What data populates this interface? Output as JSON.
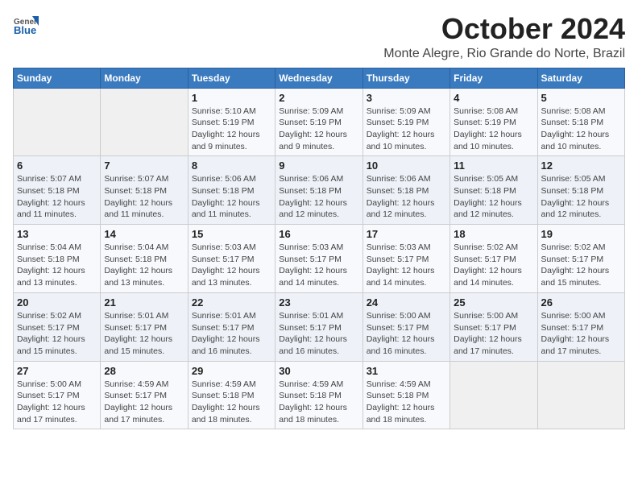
{
  "header": {
    "logo_general": "General",
    "logo_blue": "Blue",
    "month": "October 2024",
    "location": "Monte Alegre, Rio Grande do Norte, Brazil"
  },
  "weekdays": [
    "Sunday",
    "Monday",
    "Tuesday",
    "Wednesday",
    "Thursday",
    "Friday",
    "Saturday"
  ],
  "weeks": [
    [
      {
        "day": "",
        "info": ""
      },
      {
        "day": "",
        "info": ""
      },
      {
        "day": "1",
        "info": "Sunrise: 5:10 AM\nSunset: 5:19 PM\nDaylight: 12 hours and 9 minutes."
      },
      {
        "day": "2",
        "info": "Sunrise: 5:09 AM\nSunset: 5:19 PM\nDaylight: 12 hours and 9 minutes."
      },
      {
        "day": "3",
        "info": "Sunrise: 5:09 AM\nSunset: 5:19 PM\nDaylight: 12 hours and 10 minutes."
      },
      {
        "day": "4",
        "info": "Sunrise: 5:08 AM\nSunset: 5:19 PM\nDaylight: 12 hours and 10 minutes."
      },
      {
        "day": "5",
        "info": "Sunrise: 5:08 AM\nSunset: 5:18 PM\nDaylight: 12 hours and 10 minutes."
      }
    ],
    [
      {
        "day": "6",
        "info": "Sunrise: 5:07 AM\nSunset: 5:18 PM\nDaylight: 12 hours and 11 minutes."
      },
      {
        "day": "7",
        "info": "Sunrise: 5:07 AM\nSunset: 5:18 PM\nDaylight: 12 hours and 11 minutes."
      },
      {
        "day": "8",
        "info": "Sunrise: 5:06 AM\nSunset: 5:18 PM\nDaylight: 12 hours and 11 minutes."
      },
      {
        "day": "9",
        "info": "Sunrise: 5:06 AM\nSunset: 5:18 PM\nDaylight: 12 hours and 12 minutes."
      },
      {
        "day": "10",
        "info": "Sunrise: 5:06 AM\nSunset: 5:18 PM\nDaylight: 12 hours and 12 minutes."
      },
      {
        "day": "11",
        "info": "Sunrise: 5:05 AM\nSunset: 5:18 PM\nDaylight: 12 hours and 12 minutes."
      },
      {
        "day": "12",
        "info": "Sunrise: 5:05 AM\nSunset: 5:18 PM\nDaylight: 12 hours and 12 minutes."
      }
    ],
    [
      {
        "day": "13",
        "info": "Sunrise: 5:04 AM\nSunset: 5:18 PM\nDaylight: 12 hours and 13 minutes."
      },
      {
        "day": "14",
        "info": "Sunrise: 5:04 AM\nSunset: 5:18 PM\nDaylight: 12 hours and 13 minutes."
      },
      {
        "day": "15",
        "info": "Sunrise: 5:03 AM\nSunset: 5:17 PM\nDaylight: 12 hours and 13 minutes."
      },
      {
        "day": "16",
        "info": "Sunrise: 5:03 AM\nSunset: 5:17 PM\nDaylight: 12 hours and 14 minutes."
      },
      {
        "day": "17",
        "info": "Sunrise: 5:03 AM\nSunset: 5:17 PM\nDaylight: 12 hours and 14 minutes."
      },
      {
        "day": "18",
        "info": "Sunrise: 5:02 AM\nSunset: 5:17 PM\nDaylight: 12 hours and 14 minutes."
      },
      {
        "day": "19",
        "info": "Sunrise: 5:02 AM\nSunset: 5:17 PM\nDaylight: 12 hours and 15 minutes."
      }
    ],
    [
      {
        "day": "20",
        "info": "Sunrise: 5:02 AM\nSunset: 5:17 PM\nDaylight: 12 hours and 15 minutes."
      },
      {
        "day": "21",
        "info": "Sunrise: 5:01 AM\nSunset: 5:17 PM\nDaylight: 12 hours and 15 minutes."
      },
      {
        "day": "22",
        "info": "Sunrise: 5:01 AM\nSunset: 5:17 PM\nDaylight: 12 hours and 16 minutes."
      },
      {
        "day": "23",
        "info": "Sunrise: 5:01 AM\nSunset: 5:17 PM\nDaylight: 12 hours and 16 minutes."
      },
      {
        "day": "24",
        "info": "Sunrise: 5:00 AM\nSunset: 5:17 PM\nDaylight: 12 hours and 16 minutes."
      },
      {
        "day": "25",
        "info": "Sunrise: 5:00 AM\nSunset: 5:17 PM\nDaylight: 12 hours and 17 minutes."
      },
      {
        "day": "26",
        "info": "Sunrise: 5:00 AM\nSunset: 5:17 PM\nDaylight: 12 hours and 17 minutes."
      }
    ],
    [
      {
        "day": "27",
        "info": "Sunrise: 5:00 AM\nSunset: 5:17 PM\nDaylight: 12 hours and 17 minutes."
      },
      {
        "day": "28",
        "info": "Sunrise: 4:59 AM\nSunset: 5:17 PM\nDaylight: 12 hours and 17 minutes."
      },
      {
        "day": "29",
        "info": "Sunrise: 4:59 AM\nSunset: 5:18 PM\nDaylight: 12 hours and 18 minutes."
      },
      {
        "day": "30",
        "info": "Sunrise: 4:59 AM\nSunset: 5:18 PM\nDaylight: 12 hours and 18 minutes."
      },
      {
        "day": "31",
        "info": "Sunrise: 4:59 AM\nSunset: 5:18 PM\nDaylight: 12 hours and 18 minutes."
      },
      {
        "day": "",
        "info": ""
      },
      {
        "day": "",
        "info": ""
      }
    ]
  ]
}
